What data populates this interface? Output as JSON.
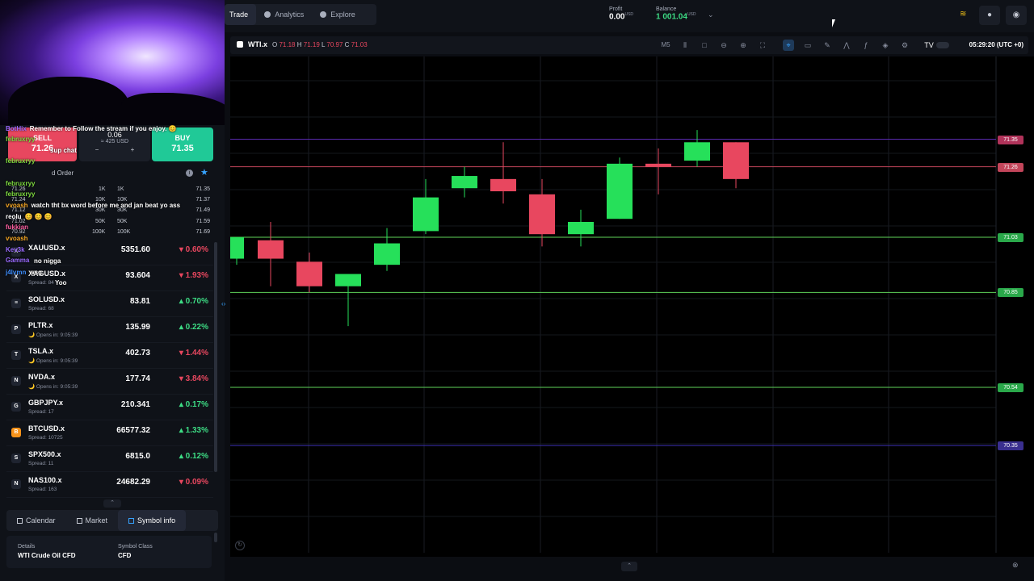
{
  "topbar": {
    "tabs": [
      {
        "label": "Trade",
        "icon": "trade-icon"
      },
      {
        "label": "Analytics",
        "icon": "analytics-icon"
      },
      {
        "label": "Explore",
        "icon": "explore-icon"
      }
    ],
    "profit_label": "Profit",
    "profit_value": "0.00",
    "profit_currency": "USD",
    "balance_label": "Balance",
    "balance_value": "1 001.04",
    "balance_currency": "USD"
  },
  "chart_header": {
    "symbol": "WTI.x",
    "o_label": "O",
    "o": "71.18",
    "h_label": "H",
    "h": "71.19",
    "l_label": "L",
    "l": "70.97",
    "c_label": "C",
    "c": "71.03",
    "timeframe": "M5",
    "clock": "05:29:20 (UTC +0)"
  },
  "price_tags": [
    {
      "value": "71.35",
      "color": "#b0335a"
    },
    {
      "value": "71.26",
      "color": "#c2455a"
    },
    {
      "value": "71.03",
      "color": "#2aa84a"
    },
    {
      "value": "70.85",
      "color": "#2aa84a"
    },
    {
      "value": "70.54",
      "color": "#2aa84a"
    },
    {
      "value": "70.35",
      "color": "#3a2f8f"
    }
  ],
  "chart_data": {
    "type": "candlestick",
    "symbol": "WTI.x",
    "timeframe": "M5",
    "ylim": [
      70.0,
      71.62
    ],
    "candles": [
      {
        "o": 70.96,
        "h": 71.0,
        "c": 71.03,
        "l": 70.94
      },
      {
        "o": 71.02,
        "h": 71.08,
        "c": 70.96,
        "l": 70.87
      },
      {
        "o": 70.95,
        "h": 70.98,
        "c": 70.87,
        "l": 70.85
      },
      {
        "o": 70.87,
        "h": 70.88,
        "c": 70.91,
        "l": 70.74
      },
      {
        "o": 70.94,
        "h": 71.06,
        "c": 71.01,
        "l": 70.92
      },
      {
        "o": 71.05,
        "h": 71.22,
        "c": 71.16,
        "l": 71.04
      },
      {
        "o": 71.19,
        "h": 71.26,
        "c": 71.23,
        "l": 71.16
      },
      {
        "o": 71.22,
        "h": 71.34,
        "c": 71.18,
        "l": 71.14
      },
      {
        "o": 71.17,
        "h": 71.22,
        "c": 71.04,
        "l": 71.0
      },
      {
        "o": 71.04,
        "h": 71.12,
        "c": 71.08,
        "l": 71.0
      },
      {
        "o": 71.09,
        "h": 71.29,
        "c": 71.27,
        "l": 71.09
      },
      {
        "o": 71.27,
        "h": 71.32,
        "c": 71.26,
        "l": 71.17
      },
      {
        "o": 71.28,
        "h": 71.38,
        "c": 71.34,
        "l": 71.26
      },
      {
        "o": 71.34,
        "h": 71.34,
        "c": 71.22,
        "l": 71.19
      }
    ],
    "lines": [
      71.35,
      71.26,
      71.03,
      70.85,
      70.54,
      70.35
    ]
  },
  "trade": {
    "sell_label": "SELL",
    "sell_price": "71.26",
    "volume": "0.06",
    "volume_usd": "≈ 425 USD",
    "buy_label": "BUY",
    "buy_price": "71.35",
    "order_label": "d Order"
  },
  "chat": [
    {
      "user": "BotHix",
      "text": "Remember to Follow the stream if you enjoy. 😊",
      "color": "#9b6bff"
    },
    {
      "user": "februxryy",
      "text": "",
      "color": "#7fdc3f"
    },
    {
      "user": "",
      "text": "sup chat",
      "color": "#3f8fff"
    },
    {
      "user": "februxryy",
      "text": "",
      "color": "#7fdc3f"
    },
    {
      "user": "",
      "text": "",
      "color": "#7fdc3f"
    },
    {
      "user": "februxryy",
      "text": "",
      "color": "#7fdc3f"
    },
    {
      "user": "februxryy",
      "text": "",
      "color": "#7fdc3f"
    },
    {
      "user": "vvoash",
      "text": "watch tht bx word before me and jan beat yo ass",
      "color": "#f5a623"
    },
    {
      "user": "reolu",
      "text": "😊 😊 😊",
      "color": "#ffffff"
    },
    {
      "user": "fukkian",
      "text": "",
      "color": "#ff5fa2"
    },
    {
      "user": "vvoash",
      "text": "",
      "color": "#f5a623"
    },
    {
      "user": "Kev3k",
      "text": "no nigga",
      "color": "#9b6bff"
    },
    {
      "user": "Gamma",
      "text": "",
      "color": "#9b6bff"
    },
    {
      "user": "j4lvmn",
      "text": "wsg",
      "color": "#3f8fff"
    },
    {
      "user": "",
      "text": "Yoo",
      "color": "#ff5fa2"
    }
  ],
  "ladder": [
    {
      "left": "71.26",
      "qty1": "1K",
      "qty2": "1K",
      "right": "71.35"
    },
    {
      "left": "71.24",
      "qty1": "10K",
      "qty2": "10K",
      "right": "71.37"
    },
    {
      "left": "71.12",
      "qty1": "30K",
      "qty2": "30K",
      "right": "71.49"
    },
    {
      "left": "71.02",
      "qty1": "50K",
      "qty2": "50K",
      "right": "71.59"
    },
    {
      "left": "70.92",
      "qty1": "100K",
      "qty2": "100K",
      "right": "71.69"
    }
  ],
  "markets": [
    {
      "name": "XAUUSD.x",
      "sub": "",
      "price": "5351.60",
      "change": "0.60%",
      "dir": "down",
      "icon": "X"
    },
    {
      "name": "XAGUSD.x",
      "sub": "Spread: 84",
      "price": "93.604",
      "change": "1.93%",
      "dir": "down",
      "icon": "X"
    },
    {
      "name": "SOLUSD.x",
      "sub": "Spread: 68",
      "price": "83.81",
      "change": "0.70%",
      "dir": "up",
      "icon": "≡"
    },
    {
      "name": "PLTR.x",
      "sub": "Opens in: 9:05:39",
      "price": "135.99",
      "change": "0.22%",
      "dir": "up",
      "icon": "P"
    },
    {
      "name": "TSLA.x",
      "sub": "Opens in: 9:05:39",
      "price": "402.73",
      "change": "1.44%",
      "dir": "down",
      "icon": "T"
    },
    {
      "name": "NVDA.x",
      "sub": "Opens in: 9:05:39",
      "price": "177.74",
      "change": "3.84%",
      "dir": "down",
      "icon": "N"
    },
    {
      "name": "GBPJPY.x",
      "sub": "Spread: 17",
      "price": "210.341",
      "change": "0.17%",
      "dir": "up",
      "icon": "G"
    },
    {
      "name": "BTCUSD.x",
      "sub": "Spread: 10725",
      "price": "66577.32",
      "change": "1.33%",
      "dir": "up",
      "icon": "B"
    },
    {
      "name": "SPX500.x",
      "sub": "Spread: 11",
      "price": "6815.0",
      "change": "0.12%",
      "dir": "up",
      "icon": "S"
    },
    {
      "name": "NAS100.x",
      "sub": "Spread: 163",
      "price": "24682.29",
      "change": "0.09%",
      "dir": "down",
      "icon": "N"
    }
  ],
  "bottom_tabs": [
    {
      "label": "Calendar"
    },
    {
      "label": "Market"
    },
    {
      "label": "Symbol info"
    }
  ],
  "details": {
    "details_label": "Details",
    "details_value": "WTI Crude Oil CFD",
    "class_label": "Symbol Class",
    "class_value": "CFD"
  }
}
